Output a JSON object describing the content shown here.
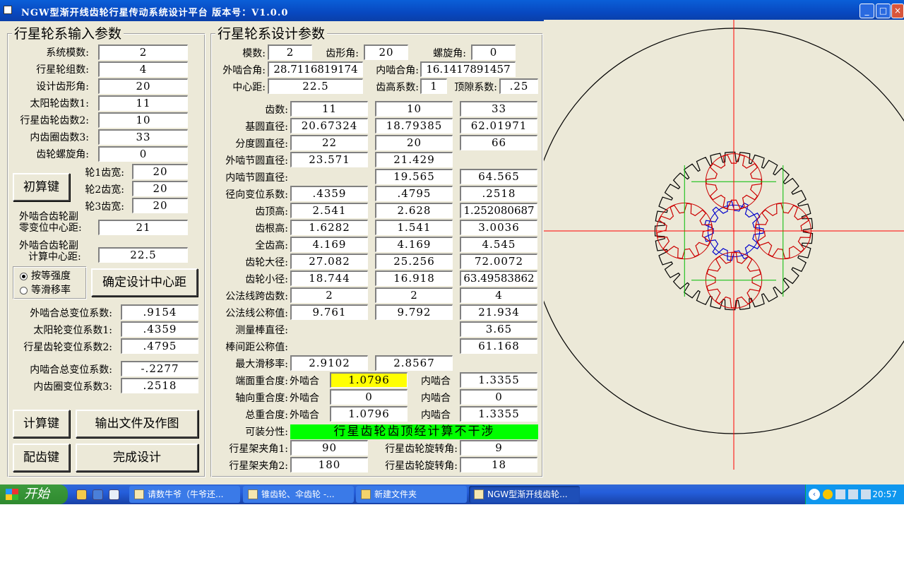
{
  "window": {
    "title": "NGW型渐开线齿轮行星传动系统设计平台    版本号：V1.0.0",
    "btn_min": "_",
    "btn_max": "□",
    "btn_close": "×"
  },
  "left": {
    "title": "行星轮系输入参数",
    "fields": [
      {
        "label": "系统模数:",
        "value": "2"
      },
      {
        "label": "行星轮组数:",
        "value": "4"
      },
      {
        "label": "设计齿形角:",
        "value": "20"
      },
      {
        "label": "太阳轮齿数1:",
        "value": "11"
      },
      {
        "label": "行星齿轮齿数2:",
        "value": "10"
      },
      {
        "label": "内齿圈齿数3:",
        "value": "33"
      },
      {
        "label": "齿轮螺旋角:",
        "value": "0"
      }
    ],
    "init_button": "初算键",
    "widths": [
      {
        "label": "轮1齿宽:",
        "value": "20"
      },
      {
        "label": "轮2齿宽:",
        "value": "20"
      },
      {
        "label": "轮3齿宽:",
        "value": "20"
      }
    ],
    "zero_center": {
      "line1": "外啮合齿轮副",
      "line2": "零变位中心距:",
      "value": "21"
    },
    "calc_center": {
      "line1": "外啮合齿轮副",
      "line2": "计算中心距:",
      "value": "22.5"
    },
    "radio1": "按等强度",
    "radio2": "等滑移率",
    "confirm_button": "确定设计中心距",
    "shifts": [
      {
        "label": "外啮合总变位系数:",
        "value": ".9154"
      },
      {
        "label": "太阳轮变位系数1:",
        "value": ".4359"
      },
      {
        "label": "行星齿轮变位系数2:",
        "value": ".4795"
      },
      {
        "label": "内啮合总变位系数:",
        "value": "-.2277"
      },
      {
        "label": "内齿圈变位系数3:",
        "value": ".2518"
      }
    ],
    "calc_button": "计算键",
    "export_button": "输出文件及作图",
    "match_button": "配齿键",
    "finish_button": "完成设计"
  },
  "mid": {
    "title": "行星轮系设计参数",
    "module_label": "模数:",
    "module": "2",
    "pressure_label": "齿形角:",
    "pressure": "20",
    "helix_label": "螺旋角:",
    "helix": "0",
    "ext_angle_label": "外啮合角:",
    "ext_angle": "28.7116819174",
    "int_angle_label": "内啮合角:",
    "int_angle": "16.1417891457",
    "center_label": "中心距:",
    "center": "22.5",
    "addendum_coef_label": "齿高系数:",
    "addendum_coef": "1",
    "clearance_label": "顶隙系数:",
    "clearance": ".25",
    "rows": [
      {
        "label": "齿数:",
        "c1": "11",
        "c2": "10",
        "c3": "33"
      },
      {
        "label": "基圆直径:",
        "c1": "20.67324",
        "c2": "18.79385",
        "c3": "62.01971"
      },
      {
        "label": "分度圆直径:",
        "c1": "22",
        "c2": "20",
        "c3": "66"
      },
      {
        "label": "外啮节圆直径:",
        "c1": "23.571",
        "c2": "21.429",
        "c3": ""
      },
      {
        "label": "内啮节圆直径:",
        "c1": "",
        "c2": "19.565",
        "c3": "64.565"
      },
      {
        "label": "径向变位系数:",
        "c1": ".4359",
        "c2": ".4795",
        "c3": ".2518"
      },
      {
        "label": "齿顶高:",
        "c1": "2.541",
        "c2": "2.628",
        "c3": "1.252080687"
      },
      {
        "label": "齿根高:",
        "c1": "1.6282",
        "c2": "1.541",
        "c3": "3.0036"
      },
      {
        "label": "全齿高:",
        "c1": "4.169",
        "c2": "4.169",
        "c3": "4.545"
      },
      {
        "label": "齿轮大径:",
        "c1": "27.082",
        "c2": "25.256",
        "c3": "72.0072"
      },
      {
        "label": "齿轮小径:",
        "c1": "18.744",
        "c2": "16.918",
        "c3": "63.49583862"
      },
      {
        "label": "公法线跨齿数:",
        "c1": "2",
        "c2": "2",
        "c3": "4"
      },
      {
        "label": "公法线公称值:",
        "c1": "9.761",
        "c2": "9.792",
        "c3": "21.934"
      },
      {
        "label": "测量棒直径:",
        "c1": "",
        "c2": "",
        "c3": "3.65"
      },
      {
        "label": "棒间距公称值:",
        "c1": "",
        "c2": "",
        "c3": "61.168"
      },
      {
        "label": "最大滑移率:",
        "c1": "2.9102",
        "c2": "2.8567",
        "c3": ""
      }
    ],
    "ext_label": "外啮合",
    "int_label": "内啮合",
    "overlaps": [
      {
        "label": "端面重合度:",
        "ext": "1.0796",
        "int": "1.3355"
      },
      {
        "label": "轴向重合度:",
        "ext": "0",
        "int": "0"
      },
      {
        "label": "总重合度:",
        "ext": "1.0796",
        "int": "1.3355"
      }
    ],
    "assembly_label": "可装分性:",
    "assembly_status": "行星齿轮齿顶经计算不干涉",
    "carrier1_label": "行星架夹角1:",
    "carrier1": "90",
    "rot1_label": "行星齿轮旋转角:",
    "rot1": "9",
    "carrier2_label": "行星架夹角2:",
    "carrier2": "180",
    "rot2_label": "行星齿轮旋转角:",
    "rot2": "18"
  },
  "drawing": {
    "ring_color": "#000000",
    "planet_color": "#cc0000",
    "sun_color": "#0000cc",
    "axis_red": "#ff0000",
    "axis_green": "#00bb00"
  },
  "taskbar": {
    "start": "开始",
    "tasks": [
      "请数牛爷（牛爷还...",
      "锥齿轮、伞齿轮 -...",
      "新建文件夹",
      "NGW型渐开线齿轮..."
    ],
    "clock": "20:57"
  }
}
